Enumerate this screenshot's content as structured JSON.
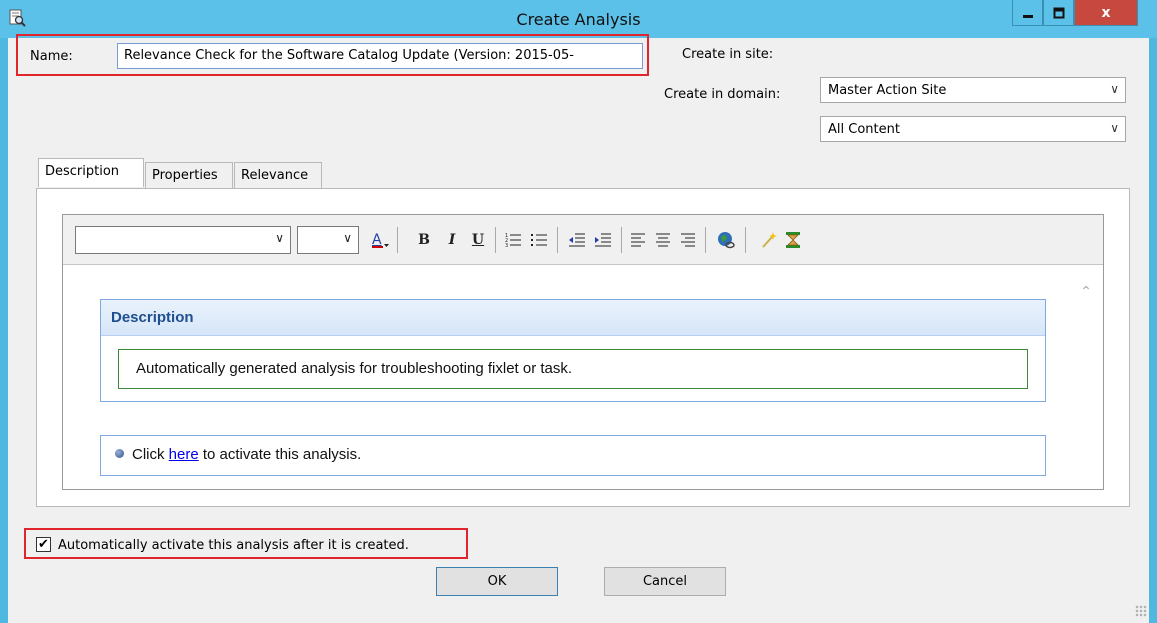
{
  "window": {
    "title": "Create Analysis",
    "close_label": "x"
  },
  "form": {
    "name_label": "Name:",
    "name_value": "Relevance Check for the Software Catalog Update (Version: 2015-05-",
    "site_label": "Create in site:",
    "site_value": "Master Action Site",
    "domain_label": "Create in domain:",
    "domain_value": "All Content"
  },
  "tabs": [
    {
      "label": "Description",
      "active": true
    },
    {
      "label": "Properties",
      "active": false
    },
    {
      "label": "Relevance",
      "active": false
    }
  ],
  "editor": {
    "toolbar_icons": [
      "font-color-icon",
      "bold-icon",
      "italic-icon",
      "underline-icon",
      "numbered-list-icon",
      "bulleted-list-icon",
      "outdent-icon",
      "indent-icon",
      "align-left-icon",
      "align-center-icon",
      "align-right-icon",
      "insert-link-icon",
      "magic-wand-icon",
      "hourglass-icon"
    ],
    "description_heading": "Description",
    "description_text": "Automatically generated analysis for troubleshooting fixlet or task.",
    "click_prefix": "Click ",
    "click_link": "here",
    "click_suffix": " to activate this analysis."
  },
  "footer": {
    "auto_activate_label": "Automatically activate this analysis after it is created.",
    "auto_activate_checked": true,
    "ok_label": "OK",
    "cancel_label": "Cancel"
  },
  "colors": {
    "title_bar": "#5cc1e8",
    "close_button": "#c7483e",
    "highlight": "#e0262c",
    "link": "#0000ee"
  }
}
